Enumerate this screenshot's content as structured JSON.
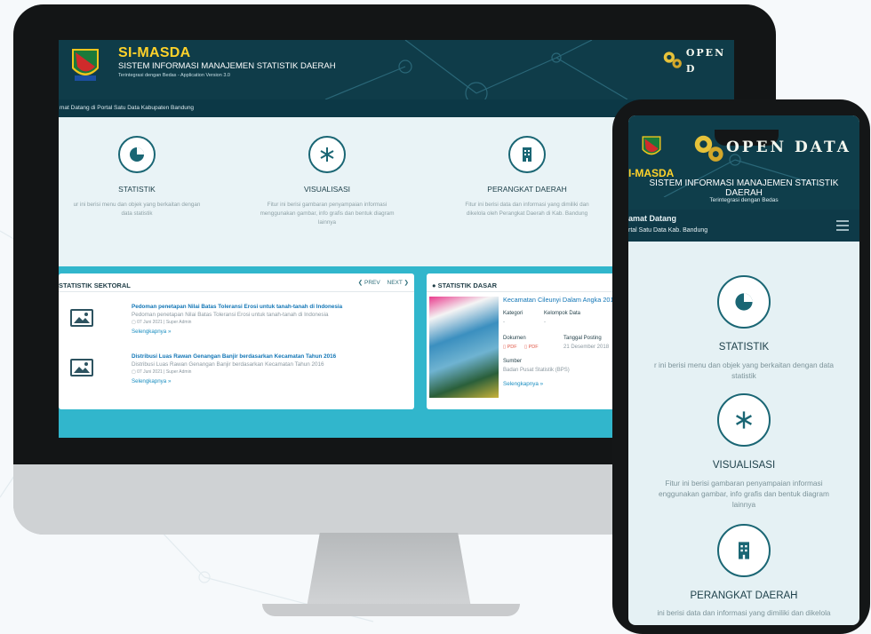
{
  "desktop": {
    "site_name": "SI-MASDA",
    "site_subtitle": "SISTEM INFORMASI MANAJEMEN STATISTIK DAERAH",
    "site_tagline": "Terintegrasi dengan Bedas - Application Version 3.0",
    "opendata_logo": "OPEN D",
    "welcome_text": "mat Datang di Portal Satu Data Kabupaten Bandung",
    "features": [
      {
        "title": "STATISTIK",
        "desc_line1": "ur ini berisi menu dan objek yang berkaitan dengan",
        "desc_line2": "data statistik",
        "icon": "pie-chart-icon"
      },
      {
        "title": "VISUALISASI",
        "desc_line1": "Fitur ini berisi gambaran penyampaian informasi",
        "desc_line2": "menggunakan gambar, info grafis dan bentuk diagram",
        "desc_line3": "lainnya",
        "icon": "snowflake-icon"
      },
      {
        "title": "PERANGKAT DAERAH",
        "desc_line1": "Fitur ini berisi data dan informasi yang dimiliki dan",
        "desc_line2": "dikelola oleh Perangkat Daerah di Kab. Bandung",
        "icon": "building-icon"
      }
    ],
    "sektoral": {
      "title": "STATISTIK SEKTORAL",
      "prev": "PREV",
      "next": "NEXT",
      "articles": [
        {
          "title": "Pedoman penetapan Nilai Batas Toleransi Erosi untuk tanah-tanah di Indonesia",
          "desc": "Pedoman penetapan Nilai Batas Toleransi Erosi untuk tanah-tanah di Indonesia",
          "meta": "07 Juni 2021 | Super Admin",
          "more": "Selengkapnya  »"
        },
        {
          "title": "Distribusi Luas Rawan Genangan Banjir berdasarkan Kecamatan Tahun 2016",
          "desc": "Distribusi Luas Rawan Genangan Banjir berdasarkan Kecamatan Tahun 2016",
          "meta": "07 Juni 2021 | Super Admin",
          "more": "Selengkapnya  »"
        }
      ]
    },
    "dasar": {
      "title": "STATISTIK DASAR",
      "item_title": "Kecamatan Cileunyi Dalam Angka 201",
      "kategori_label": "Kategori",
      "kategori_value": "-",
      "kelompok_label": "Kelompok Data",
      "kelompok_value": "-",
      "dokumen_label": "Dokumen",
      "pdf1": "PDF",
      "pdf2": "PDF",
      "tanggal_label": "Tanggal Posting",
      "tanggal_value": "21 Desember 2018",
      "sumber_label": "Sumber",
      "sumber_value": "Badan Pusat Statistik (BPS)",
      "more": "Selengkapnya  »"
    }
  },
  "mobile": {
    "opendata_logo": "OPEN DATA",
    "site_name": "I-MASDA",
    "site_subtitle_line1": "SISTEM INFORMASI MANAJEMEN STATISTIK",
    "site_subtitle_line2": "DAERAH",
    "site_tagline": "Terintegrasi dengan Bedas",
    "welcome_line1": "amat Datang",
    "welcome_line2": "rtal Satu Data Kab. Bandung",
    "features": [
      {
        "title": "STATISTIK",
        "desc_line1": "r ini berisi menu dan objek yang berkaitan dengan data",
        "desc_line2": "statistik",
        "icon": "pie-chart-icon"
      },
      {
        "title": "VISUALISASI",
        "desc_line1": "Fitur ini berisi gambaran penyampaian informasi",
        "desc_line2": "enggunakan gambar, info grafis dan bentuk diagram",
        "desc_line3": "lainnya",
        "icon": "snowflake-icon"
      },
      {
        "title": "PERANGKAT DAERAH",
        "desc_line1": "ini berisi data dan informasi yang dimiliki dan dikelola",
        "icon": "building-icon"
      }
    ]
  },
  "colors": {
    "header": "#0f3c49",
    "accent": "#31b6cc",
    "link": "#1276b6",
    "brand_yellow": "#ffd22a"
  }
}
